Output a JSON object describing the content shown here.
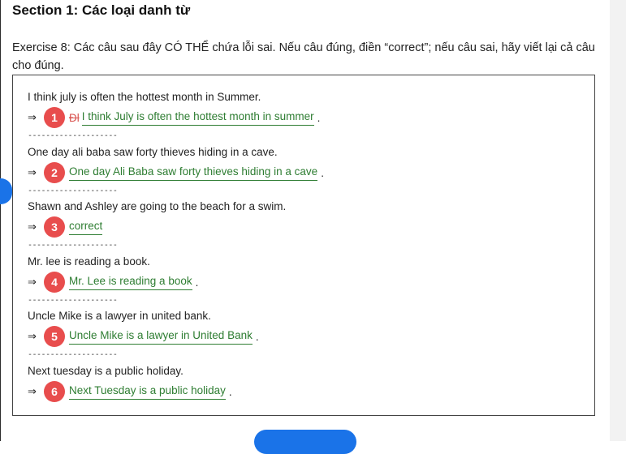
{
  "section_title": "Section 1: Các loại danh từ",
  "exercise_instruction": "Exercise 8: Các câu sau đây CÓ THỂ chứa lỗi sai. Nếu câu đúng, điền “correct”; nếu câu sai, hãy viết lại cả câu cho đúng.",
  "arrow_symbol": "⇒",
  "divider_text": "--------------------",
  "items": [
    {
      "number": "1",
      "question": "I think july is often the hottest month in Summer.",
      "struck": "Đl",
      "answer": "I think July is often the hottest month in summer",
      "period": "."
    },
    {
      "number": "2",
      "question": "One day ali baba saw forty thieves hiding in a cave.",
      "struck": "",
      "answer": "One day Ali Baba saw forty thieves hiding in a cave",
      "period": "."
    },
    {
      "number": "3",
      "question": "Shawn and Ashley are going to the beach for a swim.",
      "struck": "",
      "answer": "correct",
      "period": ""
    },
    {
      "number": "4",
      "question": "Mr. lee is reading a book.",
      "struck": "",
      "answer": "Mr. Lee is reading a book",
      "period": "."
    },
    {
      "number": "5",
      "question": "Uncle Mike is a lawyer in united bank.",
      "struck": "",
      "answer": "Uncle Mike is a lawyer in United Bank",
      "period": "."
    },
    {
      "number": "6",
      "question": "Next tuesday is a public holiday.",
      "struck": "",
      "answer": "Next Tuesday is a public holiday",
      "period": "."
    }
  ],
  "colors": {
    "badge": "#e84d4d",
    "answer": "#2e7d32",
    "accent_blue": "#1a73e8"
  }
}
